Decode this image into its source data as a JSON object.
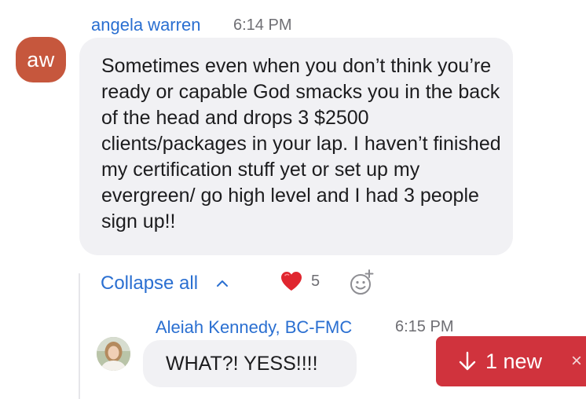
{
  "messages": [
    {
      "sender": "angela warren",
      "time": "6:14 PM",
      "avatar_initials": "aw",
      "avatar_color": "#c6573d",
      "text": "Sometimes even when you don’t think you’re ready or capable God smacks you in the back of the head and drops 3 $2500 clients/packages in your lap. I haven’t finished my certification stuff yet or set up my evergreen/ go high level and I had 3 people sign up!!"
    }
  ],
  "thread": {
    "collapse_label": "Collapse all",
    "reaction_emoji": "❤️",
    "reaction_count": "5",
    "reply": {
      "sender": "Aleiah Kennedy, BC-FMC",
      "time": "6:15 PM",
      "text": "WHAT?! YESS!!!!"
    }
  },
  "new_indicator": {
    "label": "1 new",
    "close": "×",
    "color": "#d0333d"
  },
  "colors": {
    "link": "#2a6fd1",
    "bubble": "#f1f1f4"
  }
}
